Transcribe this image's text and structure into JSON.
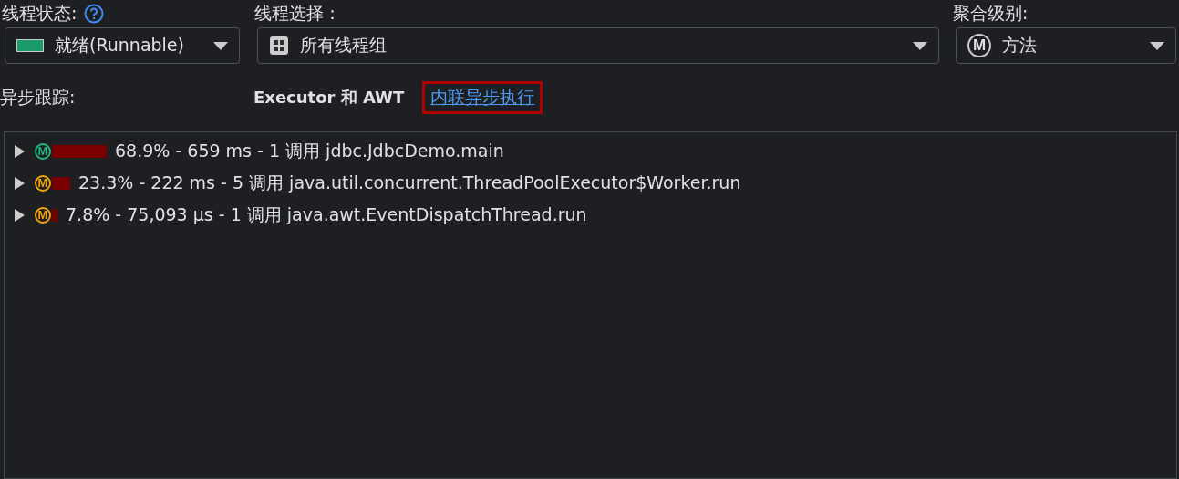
{
  "filters": [
    {
      "label": "线程状态:",
      "kind": "state",
      "value": "就绪(Runnable)",
      "has_help": true,
      "color": "#1a9b6c"
    },
    {
      "label": "线程选择：",
      "kind": "group",
      "value": "所有线程组"
    },
    {
      "label": "聚合级别:",
      "kind": "method",
      "value": "方法",
      "icon_letter": "M"
    }
  ],
  "async": {
    "label": "异步跟踪:",
    "mode": "Executor 和 AWT",
    "link": "内联异步执行",
    "link_highlighted": true
  },
  "tree": [
    {
      "icon_letter": "M",
      "color": "#1fb57f",
      "text": "68.9% - 659 ms - 1 调用 jdbc.JdbcDemo.main",
      "expanded": false
    },
    {
      "icon_letter": "M",
      "color": "#f0a30a",
      "text": "23.3% - 222 ms - 5 调用 java.util.concurrent.ThreadPoolExecutor$Worker.run",
      "expanded": false
    },
    {
      "icon_letter": "M",
      "color": "#f0a30a",
      "text": "7.8% - 75,093 µs - 1 调用 java.awt.EventDispatchThread.run",
      "expanded": false
    }
  ]
}
